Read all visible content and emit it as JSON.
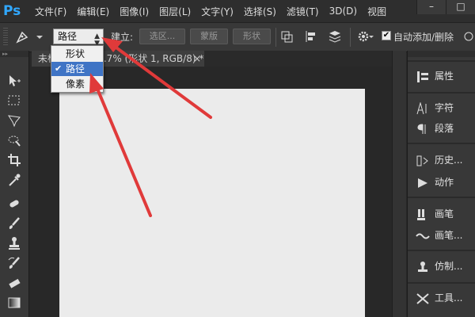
{
  "app": {
    "logo": "Ps"
  },
  "menu": [
    "文件(F)",
    "编辑(E)",
    "图像(I)",
    "图层(L)",
    "文字(Y)",
    "选择(S)",
    "滤镜(T)",
    "3D(D)",
    "视图"
  ],
  "window_controls": {
    "minimize": "–",
    "maximize": "□"
  },
  "options": {
    "mode_value": "路径",
    "create_label": "建立:",
    "selection_btn": "选区...",
    "mask_btn": "蒙版",
    "shape_btn": "形状",
    "auto_add_delete": "自动添加/删除",
    "auto_checked": "✔"
  },
  "mode_dropdown": {
    "items": [
      "形状",
      "路径",
      "像素"
    ],
    "selected_index": 1,
    "check": "✔"
  },
  "document_tab": {
    "title": "未标题-1 @ 66.7% (形状 1, RGB/8) *",
    "close": "×"
  },
  "panels": [
    {
      "label": "属性",
      "icon": "properties-icon"
    },
    {
      "label": "字符",
      "icon": "character-icon"
    },
    {
      "label": "段落",
      "icon": "paragraph-icon"
    },
    {
      "label": "历史...",
      "icon": "history-icon"
    },
    {
      "label": "动作",
      "icon": "actions-play-icon"
    },
    {
      "label": "画笔",
      "icon": "brush-icon"
    },
    {
      "label": "画笔...",
      "icon": "brush-presets-icon"
    },
    {
      "label": "仿制...",
      "icon": "clone-source-icon"
    },
    {
      "label": "工具...",
      "icon": "tool-presets-icon"
    }
  ],
  "colors": {
    "accent": "#31a8ff",
    "annotation_arrow": "#e03a3a",
    "selection": "#3f74c5",
    "canvas": "#ebebeb"
  }
}
